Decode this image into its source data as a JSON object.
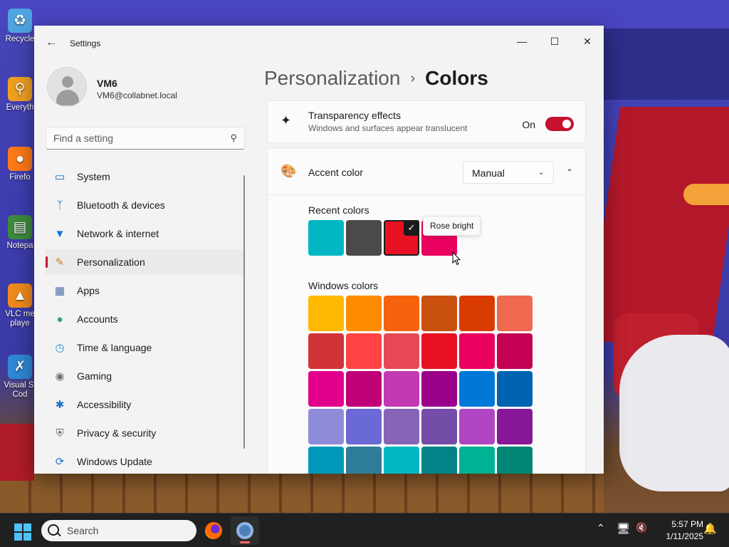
{
  "desktop": {
    "icons": [
      {
        "label": "Recycle",
        "icon": "recycle-bin-icon"
      },
      {
        "label": "Everyth",
        "icon": "everything-search-icon"
      },
      {
        "label": "Firefo",
        "icon": "firefox-icon"
      },
      {
        "label": "Notepa",
        "icon": "notepad-icon"
      },
      {
        "label": "VLC me\nplaye",
        "icon": "vlc-icon"
      },
      {
        "label": "Visual St\nCod",
        "icon": "vscode-icon"
      }
    ]
  },
  "window": {
    "title": "Settings",
    "back_icon": "back-arrow-icon",
    "controls": {
      "minimize": "—",
      "maximize": "☐",
      "close": "✕"
    }
  },
  "profile": {
    "name": "VM6",
    "email": "VM6@collabnet.local"
  },
  "search": {
    "placeholder": "Find a setting",
    "value": ""
  },
  "nav": {
    "items": [
      {
        "label": "System",
        "icon": "system-display-icon",
        "color": "#0067c0",
        "active": false
      },
      {
        "label": "Bluetooth & devices",
        "icon": "bluetooth-icon",
        "color": "#0078d4",
        "active": false
      },
      {
        "label": "Network & internet",
        "icon": "wifi-icon",
        "color": "#0e75d3",
        "active": false
      },
      {
        "label": "Personalization",
        "icon": "paintbrush-icon",
        "color": "#d77b2e",
        "active": true
      },
      {
        "label": "Apps",
        "icon": "apps-icon",
        "color": "#4b6fa8",
        "active": false
      },
      {
        "label": "Accounts",
        "icon": "accounts-icon",
        "color": "#2aa37a",
        "active": false
      },
      {
        "label": "Time & language",
        "icon": "globe-clock-icon",
        "color": "#1a8bd6",
        "active": false
      },
      {
        "label": "Gaming",
        "icon": "gamepad-icon",
        "color": "#6f6f6f",
        "active": false
      },
      {
        "label": "Accessibility",
        "icon": "accessibility-icon",
        "color": "#1b6fc7",
        "active": false
      },
      {
        "label": "Privacy & security",
        "icon": "shield-icon",
        "color": "#6b6b6b",
        "active": false
      },
      {
        "label": "Windows Update",
        "icon": "update-icon",
        "color": "#1a73d9",
        "active": false
      }
    ]
  },
  "breadcrumb": {
    "parent": "Personalization",
    "separator": "›",
    "current": "Colors"
  },
  "transparency": {
    "title": "Transparency effects",
    "subtitle": "Windows and surfaces appear translucent",
    "state_label": "On",
    "enabled": true,
    "accent": "#c4122f"
  },
  "accent": {
    "title": "Accent color",
    "mode": "Manual"
  },
  "recent_colors": {
    "label": "Recent colors",
    "colors": [
      "#00b7c3",
      "#4c4a48",
      "#e81123",
      "#ea005e"
    ],
    "selected_index": 2,
    "tooltip": "Rose bright"
  },
  "windows_colors": {
    "label": "Windows colors",
    "rows": [
      [
        "#ffb900",
        "#ff8c00",
        "#f7630c",
        "#ca5010",
        "#da3b01",
        "#ef6950"
      ],
      [
        "#d13438",
        "#ff4343",
        "#e74856",
        "#e81123",
        "#ea005e",
        "#c30052"
      ],
      [
        "#e3008c",
        "#bf0077",
        "#c239b3",
        "#9a0089",
        "#0078d7",
        "#0063b1"
      ],
      [
        "#8e8cd8",
        "#6b69d6",
        "#8764b8",
        "#744da9",
        "#b146c2",
        "#881798"
      ],
      [
        "#0099bc",
        "#2d7d9a",
        "#00b7c3",
        "#038387",
        "#00b294",
        "#018574"
      ]
    ]
  },
  "taskbar": {
    "search_label": "Search",
    "apps": [
      {
        "name": "firefox-icon",
        "active": false
      },
      {
        "name": "settings-icon",
        "active": true
      }
    ],
    "time": "5:57 PM",
    "date": "1/11/2025"
  }
}
